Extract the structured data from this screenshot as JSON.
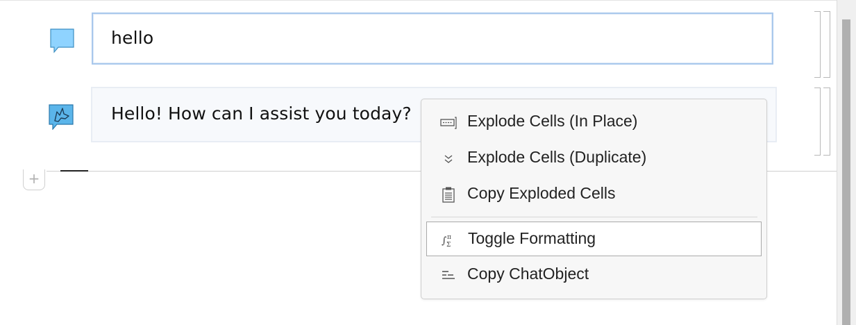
{
  "chat": {
    "user_message": "hello",
    "assistant_message": "Hello! How can I assist you today?"
  },
  "add_cell_symbol": "+",
  "context_menu": {
    "items": [
      {
        "label": "Explode Cells (In Place)",
        "icon": "explode-in-place-icon"
      },
      {
        "label": "Explode Cells (Duplicate)",
        "icon": "double-chevron-down-icon"
      },
      {
        "label": "Copy Exploded Cells",
        "icon": "clipboard-icon"
      },
      {
        "label": "Toggle Formatting",
        "icon": "integral-sum-icon",
        "highlighted": true
      },
      {
        "label": "Copy ChatObject",
        "icon": "chat-object-lines-icon"
      }
    ]
  },
  "colors": {
    "input_border": "#a9c8ec",
    "user_icon": "#8fd3ff",
    "assistant_icon": "#4aa8e0",
    "menu_background": "#f7f7f7"
  }
}
